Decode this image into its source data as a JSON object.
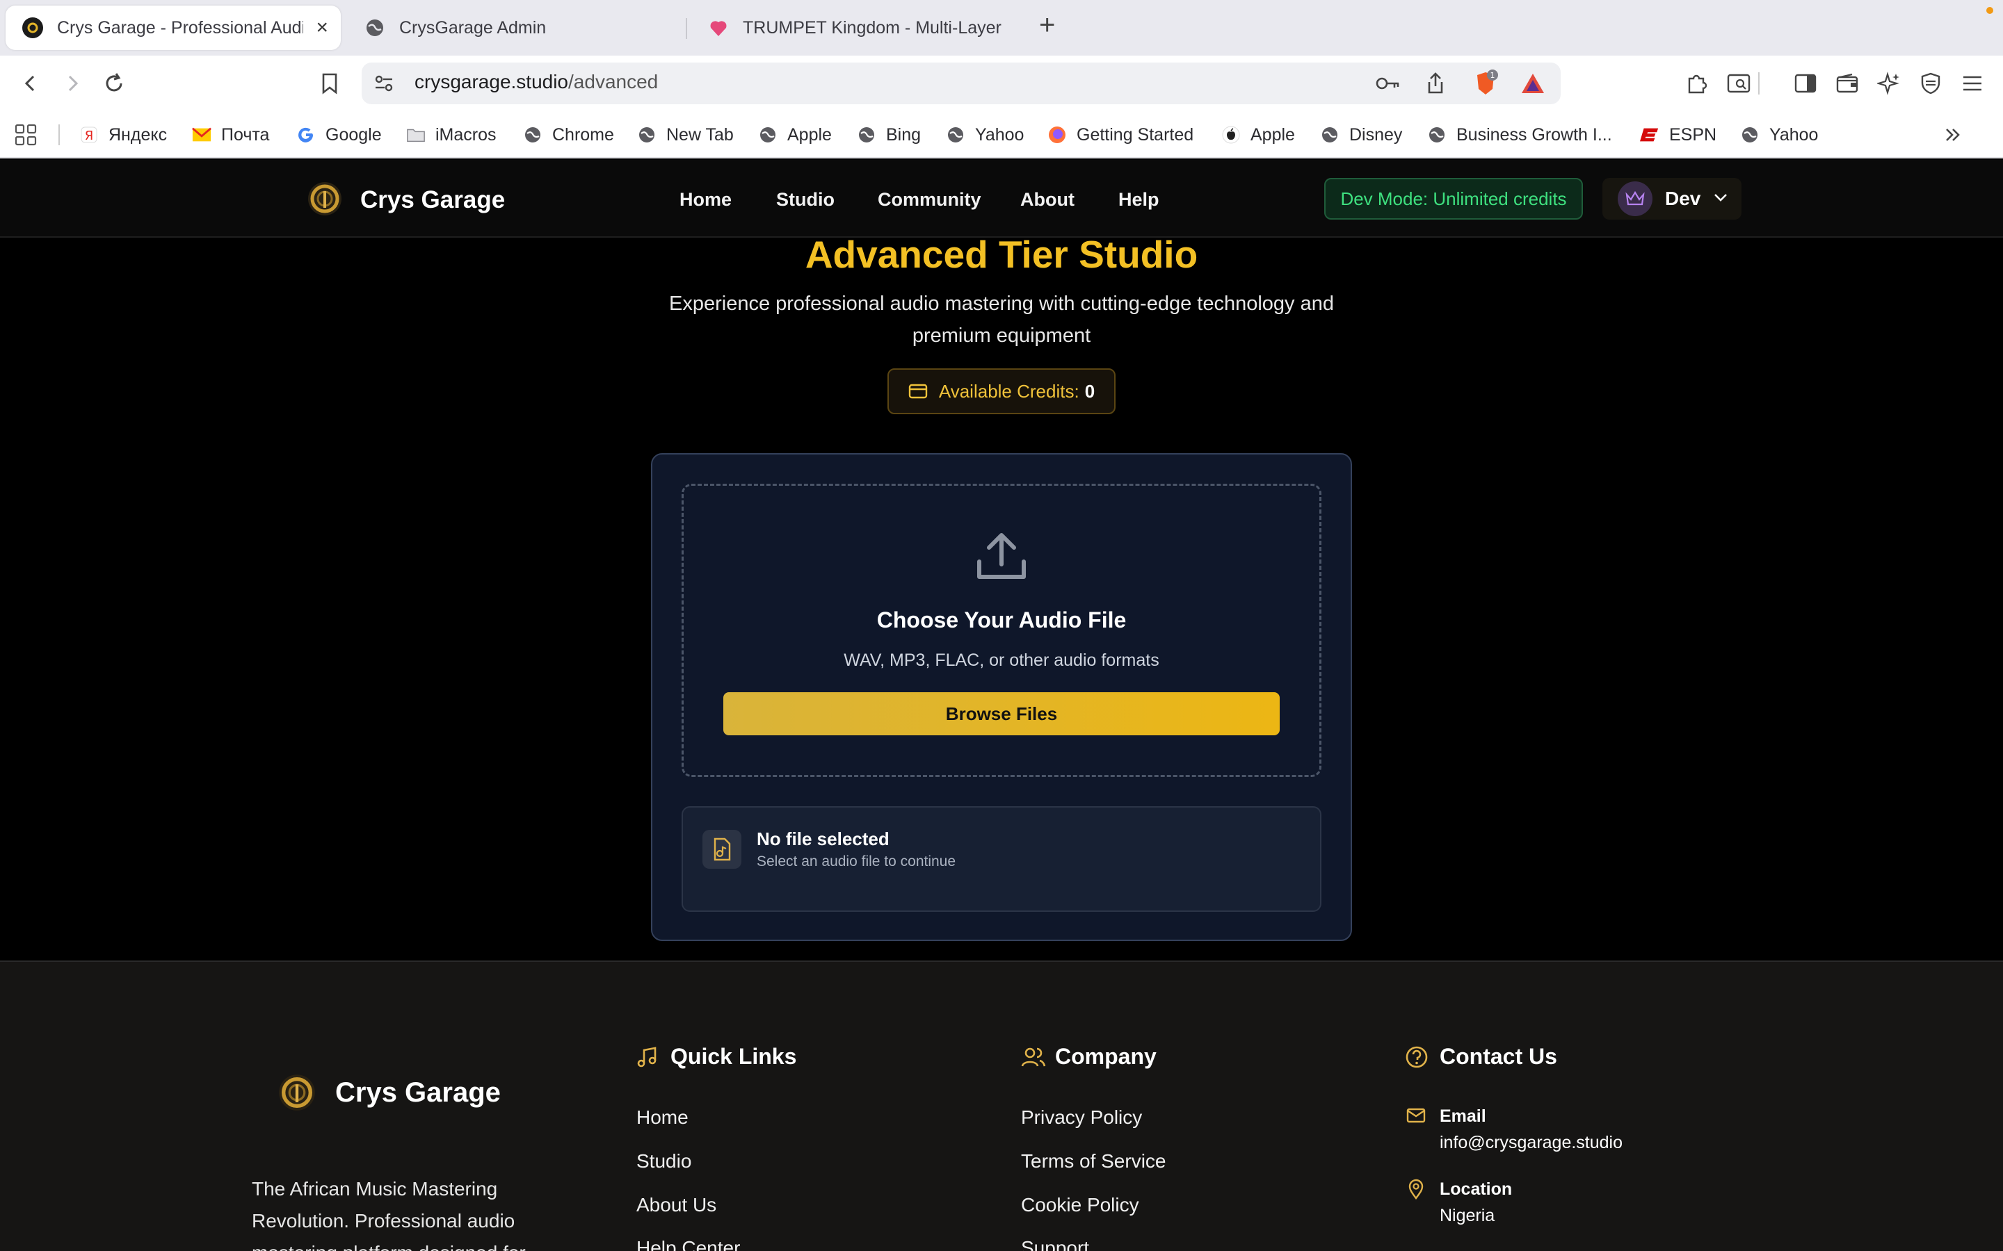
{
  "browser": {
    "tabs": [
      {
        "title": "Crys Garage - Professional Audio"
      },
      {
        "title": "CrysGarage Admin"
      },
      {
        "title": "TRUMPET Kingdom - Multi-Layered"
      }
    ],
    "url_host": "crysgarage.studio",
    "url_path": "/advanced",
    "shields_count": "1",
    "bookmarks": [
      {
        "label": "Яндекс",
        "icon": "yandex-icon"
      },
      {
        "label": "Почта",
        "icon": "mail-icon"
      },
      {
        "label": "Google",
        "icon": "google-icon"
      },
      {
        "label": "iMacros",
        "icon": "folder-icon"
      },
      {
        "label": "Chrome",
        "icon": "globe-icon"
      },
      {
        "label": "New Tab",
        "icon": "globe-icon"
      },
      {
        "label": "Apple",
        "icon": "globe-icon"
      },
      {
        "label": "Bing",
        "icon": "globe-icon"
      },
      {
        "label": "Yahoo",
        "icon": "globe-icon"
      },
      {
        "label": "Getting Started",
        "icon": "firefox-icon"
      },
      {
        "label": "Apple",
        "icon": "apple-icon"
      },
      {
        "label": "Disney",
        "icon": "globe-icon"
      },
      {
        "label": "Business Growth I...",
        "icon": "globe-icon"
      },
      {
        "label": "ESPN",
        "icon": "espn-icon"
      },
      {
        "label": "Yahoo",
        "icon": "globe-icon"
      }
    ]
  },
  "site": {
    "brand": "Crys Garage",
    "nav": [
      "Home",
      "Studio",
      "Community",
      "About",
      "Help"
    ],
    "dev_mode": "Dev Mode: Unlimited credits",
    "user": "Dev"
  },
  "main": {
    "title": "Advanced Tier Studio",
    "subtitle": "Experience professional audio mastering with cutting-edge technology and premium equipment",
    "credits_label": "Available Credits:",
    "credits_value": "0",
    "upload_title": "Choose Your Audio File",
    "upload_formats": "WAV, MP3, FLAC, or other audio formats",
    "browse_label": "Browse Files",
    "file_status_title": "No file selected",
    "file_status_sub": "Select an audio file to continue"
  },
  "footer": {
    "brand": "Crys Garage",
    "description": "The African Music Mastering Revolution. Professional audio mastering platform designed for",
    "quick_links": {
      "title": "Quick Links",
      "items": [
        "Home",
        "Studio",
        "About Us",
        "Help Center"
      ]
    },
    "company": {
      "title": "Company",
      "items": [
        "Privacy Policy",
        "Terms of Service",
        "Cookie Policy",
        "Support"
      ]
    },
    "contact": {
      "title": "Contact Us",
      "email_label": "Email",
      "email_value": "info@crysgarage.studio",
      "location_label": "Location",
      "location_value": "Nigeria"
    }
  },
  "colors": {
    "accent": "#f3c024",
    "success": "#3ee07f",
    "panel": "#0f172a",
    "footer": "#161514"
  }
}
